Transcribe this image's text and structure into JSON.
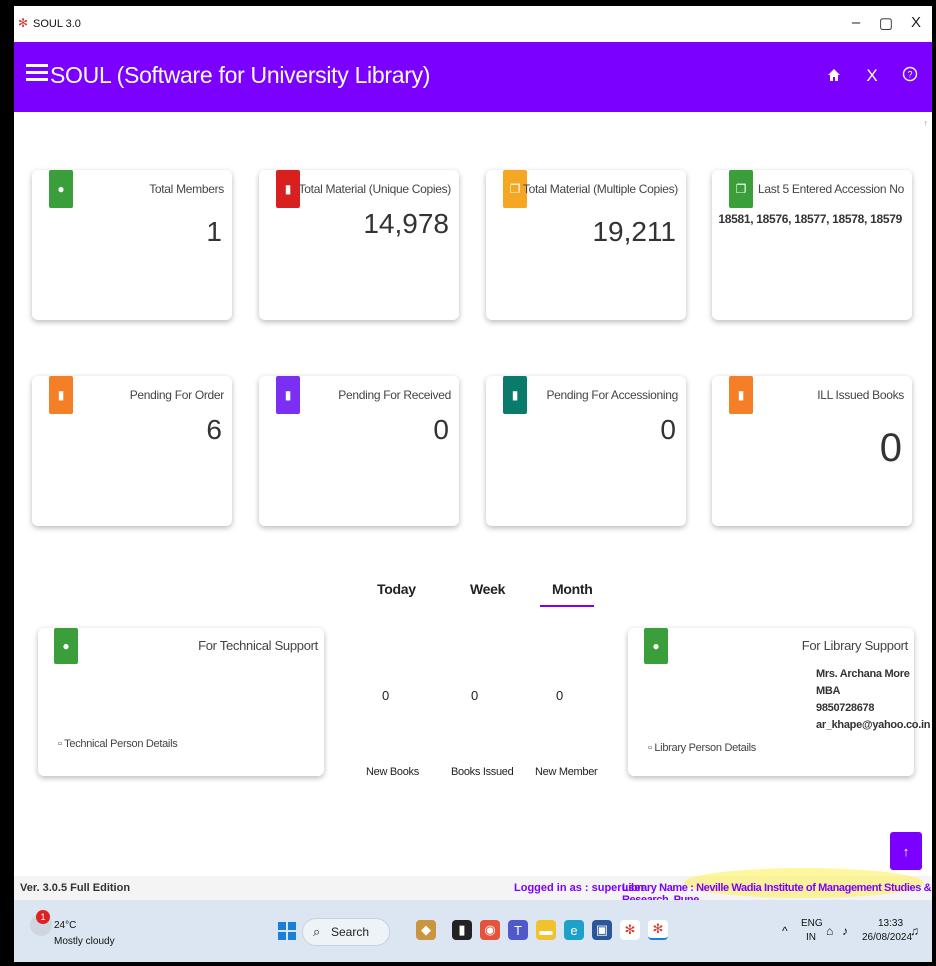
{
  "window": {
    "title": "SOUL 3.0",
    "minimize": "–",
    "maximize": "▢",
    "close": "X"
  },
  "header": {
    "title": "SOUL (Software for University Library)",
    "home_icon": "home-icon",
    "close_icon": "close-icon",
    "help_icon": "help-icon"
  },
  "cards": [
    {
      "label": "Total Members",
      "value": "1",
      "color": "#3a9e3a"
    },
    {
      "label": "Total Material (Unique Copies)",
      "value": "14,978",
      "color": "#d82020"
    },
    {
      "label": "Total Material (Multiple Copies)",
      "value": "19,211",
      "color": "#f5a623"
    },
    {
      "label": "Last 5 Entered Accession No",
      "value": "18581, 18576, 18577, 18578, 18579",
      "color": "#3a9e3a"
    },
    {
      "label": "Pending For Order",
      "value": "6",
      "color": "#f57f26"
    },
    {
      "label": "Pending For Received",
      "value": "0",
      "color": "#7b2ff2"
    },
    {
      "label": "Pending For Accessioning",
      "value": "0",
      "color": "#0a7a6a"
    },
    {
      "label": "ILL Issued Books",
      "value": "0",
      "color": "#f57f26"
    }
  ],
  "tabs": {
    "today": "Today",
    "week": "Week",
    "month": "Month",
    "active": "Month"
  },
  "stats": {
    "new_books": {
      "value": "0",
      "label": "New Books"
    },
    "books_issued": {
      "value": "0",
      "label": "Books Issued"
    },
    "new_member": {
      "value": "0",
      "label": "New Member"
    }
  },
  "technical_support": {
    "title": "For Technical Support",
    "link": "Technical Person Details"
  },
  "library_support": {
    "title": "For Library Support",
    "link": "Library Person Details",
    "name": "Mrs. Archana More",
    "qualification": "MBA",
    "phone": "9850728678",
    "email": "ar_khape@yahoo.co.in"
  },
  "scroll_up": "↑",
  "status": {
    "version": "Ver. 3.0.5  Full Edition",
    "logged_in": "Logged in as : superuser",
    "library": "Library Name : Neville Wadia Institute of Management Studies & Research, Pune"
  },
  "taskbar": {
    "weather_badge": "1",
    "temperature": "24°C",
    "condition": "Mostly cloudy",
    "search": "Search",
    "lang_line1": "ENG",
    "lang_line2": "IN",
    "time": "13:33",
    "date": "26/08/2024"
  }
}
